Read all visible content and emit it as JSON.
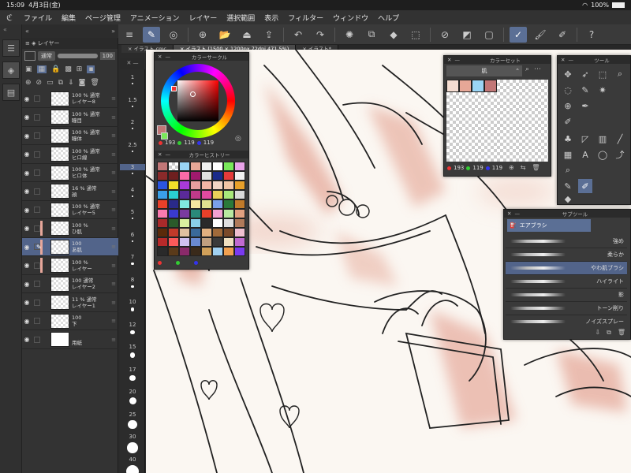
{
  "status": {
    "time": "15:09",
    "date": "4月3日(金)",
    "battery": "100%"
  },
  "menu": [
    "ファイル",
    "編集",
    "ページ管理",
    "アニメーション",
    "レイヤー",
    "選択範囲",
    "表示",
    "フィルター",
    "ウィンドウ",
    "ヘルプ"
  ],
  "tabs": [
    {
      "label": "イラスト.cmc",
      "active": false
    },
    {
      "label": "イラスト (1500 × 1200px 72dpi 471.5%)",
      "active": true
    },
    {
      "label": "イラスト*",
      "active": false
    }
  ],
  "layer_panel": {
    "title": "レイヤー",
    "blend_mode": "通常",
    "opacity": "100",
    "layers": [
      {
        "pct": "100 %",
        "mode": "通常",
        "name": "レイヤー8",
        "selected": false,
        "color": ""
      },
      {
        "pct": "100 %",
        "mode": "通常",
        "name": "瞳目",
        "selected": false,
        "color": ""
      },
      {
        "pct": "100 %",
        "mode": "通常",
        "name": "瞳体",
        "selected": false,
        "color": ""
      },
      {
        "pct": "100 %",
        "mode": "通常",
        "name": "ヒロ線",
        "selected": false,
        "color": ""
      },
      {
        "pct": "100 %",
        "mode": "通常",
        "name": "ヒロ体",
        "selected": false,
        "color": ""
      },
      {
        "pct": "16 %",
        "mode": "通常",
        "name": "顔",
        "selected": false,
        "color": ""
      },
      {
        "pct": "100 %",
        "mode": "通常",
        "name": "レイヤー5",
        "selected": false,
        "color": ""
      },
      {
        "pct": "100 %",
        "mode": "",
        "name": "ひ肌",
        "selected": false,
        "color": "#e7a79b"
      },
      {
        "pct": "100",
        "mode": "",
        "name": "あ肌",
        "selected": true,
        "color": "#e7a79b"
      },
      {
        "pct": "100 %",
        "mode": "",
        "name": "レイヤー",
        "selected": false,
        "color": "#e7a79b"
      },
      {
        "pct": "100",
        "mode": "通常",
        "name": "レイヤー2",
        "selected": false,
        "color": ""
      },
      {
        "pct": "11 %",
        "mode": "通常",
        "name": "レイヤー1",
        "selected": false,
        "color": ""
      },
      {
        "pct": "100",
        "mode": "",
        "name": "下",
        "selected": false,
        "color": ""
      },
      {
        "pct": "",
        "mode": "",
        "name": "用紙",
        "selected": false,
        "color": ""
      }
    ]
  },
  "brush_sizes": [
    "1",
    "1.5",
    "2",
    "2.5",
    "3",
    "4",
    "5",
    "6",
    "7",
    "8",
    "10",
    "12",
    "15",
    "17",
    "20",
    "25",
    "30",
    "40"
  ],
  "color_circle": {
    "title": "カラーサークル",
    "r": "193",
    "g": "119",
    "b": "119",
    "current_color": "#c17777"
  },
  "color_history": {
    "title": "カラーヒストリー",
    "swatches": [
      "#c17777",
      "checker",
      "#9ad5f5",
      "#e6a797",
      "#f0f0f0",
      "#ffffff",
      "#79e85a",
      "#e9a3e9",
      "#8a2a2a",
      "#6e1f1f",
      "#fb6aa7",
      "#a01a6e",
      "#e0e0e0",
      "#1a2a8a",
      "#e53a3a",
      "#f2f2f2",
      "#2a55e0",
      "#f2e22a",
      "#a83ad9",
      "#e6a0a0",
      "#f5b5a5",
      "#f2d4c4",
      "#f2c5a5",
      "#e8a02a",
      "#3aa0e8",
      "#2ad0d0",
      "#5a2a9a",
      "#c03a8a",
      "#e04aa0",
      "#e8d05a",
      "#a8e87a",
      "#d9d9d9",
      "#e8402a",
      "#2a2a8a",
      "#80e8e0",
      "#f5e8a0",
      "#e0e090",
      "#7aa0e8",
      "#2a7a3a",
      "#c07a2a",
      "#fa7ab0",
      "#3a3ad0",
      "#7a3aa0",
      "#2a8a7a",
      "#e8402a",
      "#f0a0d0",
      "#b8e8a0",
      "#e0a080",
      "#aa2a2a",
      "#2a5a2a",
      "#d9f0a0",
      "#8ad0e8",
      "#2a2a2a",
      "#ffffff",
      "#e0e0e0",
      "#b07a5a",
      "#5a2a0a",
      "#c03a2a",
      "#e0c0a0",
      "#3a6a9a",
      "#e0b080",
      "#a06a3a",
      "#7a4a2a",
      "#f0c0d0",
      "#b82a2a",
      "#fa5a5a",
      "#d0c0f0",
      "#6a8ad0",
      "#c0a080",
      "#3a3a3a",
      "#f0e0c0",
      "#c06ad0",
      "#2a2a2a",
      "#5a3a1a",
      "#8a2a6a",
      "#3a2a1a",
      "#d0a05a",
      "#a0d0f0",
      "#f0a050",
      "#7a3af0"
    ]
  },
  "color_set": {
    "title": "カラーセット",
    "set_name": "肌",
    "swatches": [
      "#f5ddd2",
      "#e6a797",
      "#9ad5f5",
      "#c17777"
    ],
    "r": "193",
    "g": "119",
    "b": "119"
  },
  "tool_panel": {
    "title": "ツール"
  },
  "subtool": {
    "title": "サブツール",
    "group": "エアブラシ",
    "brushes": [
      {
        "name": "強め",
        "selected": false
      },
      {
        "name": "柔らか",
        "selected": false
      },
      {
        "name": "やわ肌ブラシ",
        "selected": true
      },
      {
        "name": "ハイライト",
        "selected": false
      },
      {
        "name": "影",
        "selected": false
      },
      {
        "name": "トーン削り",
        "selected": false
      },
      {
        "name": "ノイズスプレー",
        "selected": false
      }
    ]
  }
}
